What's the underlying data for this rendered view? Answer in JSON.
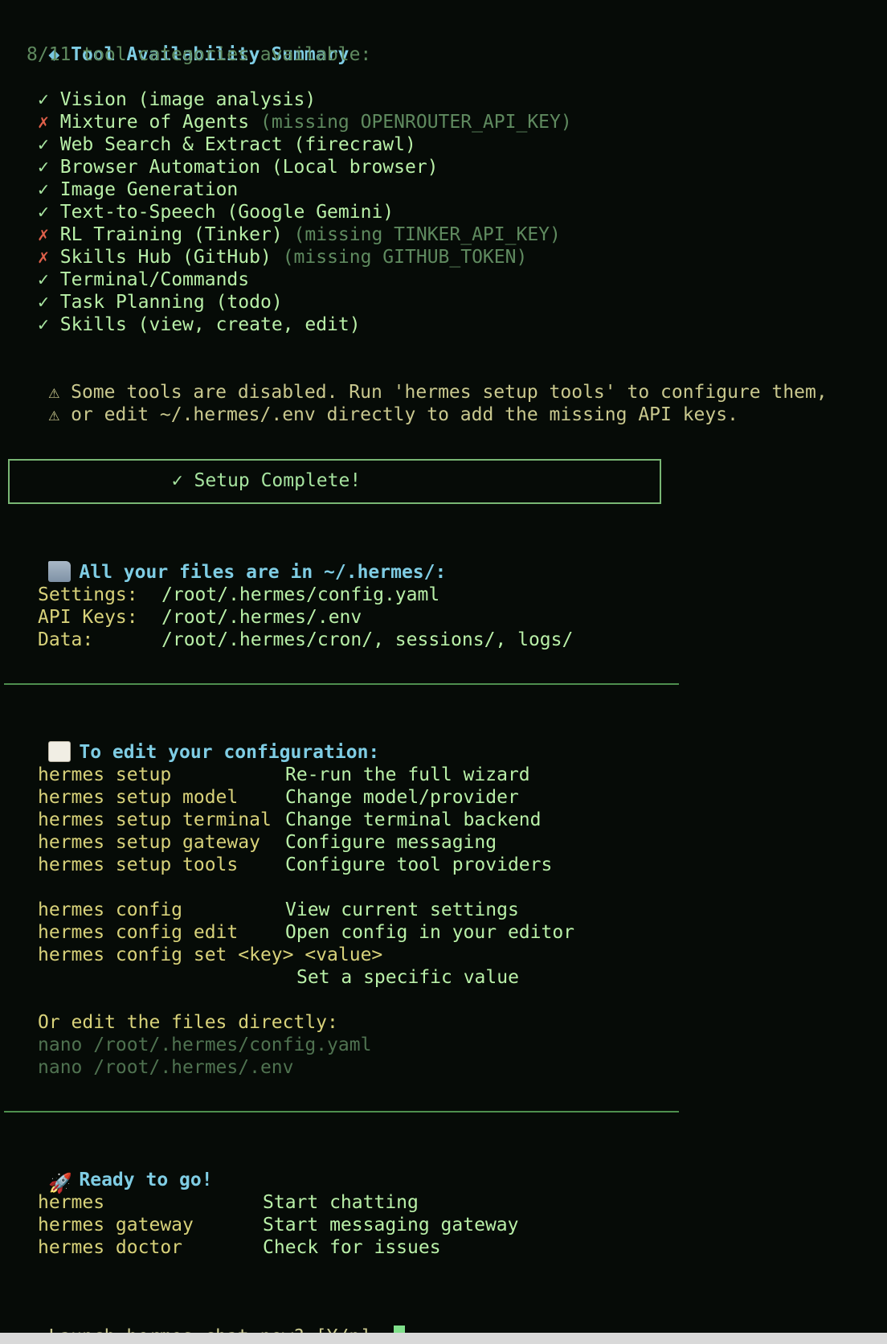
{
  "summary": {
    "bullet": "◆",
    "title": "Tool Availability Summary",
    "count_line": "8/11 tool categories available:"
  },
  "tools": [
    {
      "mark": "✓",
      "name": "Vision (image analysis)",
      "note": "",
      "ok": true
    },
    {
      "mark": "✗",
      "name": "Mixture of Agents",
      "note": "(missing OPENROUTER_API_KEY)",
      "ok": false
    },
    {
      "mark": "✓",
      "name": "Web Search & Extract (firecrawl)",
      "note": "",
      "ok": true
    },
    {
      "mark": "✓",
      "name": "Browser Automation (Local browser)",
      "note": "",
      "ok": true
    },
    {
      "mark": "✓",
      "name": "Image Generation",
      "note": "",
      "ok": true
    },
    {
      "mark": "✓",
      "name": "Text-to-Speech (Google Gemini)",
      "note": "",
      "ok": true
    },
    {
      "mark": "✗",
      "name": "RL Training (Tinker)",
      "note": "(missing TINKER_API_KEY)",
      "ok": false
    },
    {
      "mark": "✗",
      "name": "Skills Hub (GitHub)",
      "note": "(missing GITHUB_TOKEN)",
      "ok": false
    },
    {
      "mark": "✓",
      "name": "Terminal/Commands",
      "note": "",
      "ok": true
    },
    {
      "mark": "✓",
      "name": "Task Planning (todo)",
      "note": "",
      "ok": true
    },
    {
      "mark": "✓",
      "name": "Skills (view, create, edit)",
      "note": "",
      "ok": true
    }
  ],
  "warnings": [
    {
      "icon": "⚠",
      "text": "Some tools are disabled. Run 'hermes setup tools' to configure them,"
    },
    {
      "icon": "⚠",
      "text": "or edit ~/.hermes/.env directly to add the missing API keys."
    }
  ],
  "setup_box": {
    "text": "✓ Setup Complete!"
  },
  "files": {
    "heading": "All your files are in ~/.hermes/:",
    "rows": [
      {
        "label": "Settings:",
        "value": "/root/.hermes/config.yaml"
      },
      {
        "label": "API Keys:",
        "value": "/root/.hermes/.env"
      },
      {
        "label": "Data:",
        "value": "/root/.hermes/cron/, sessions/, logs/"
      }
    ]
  },
  "config": {
    "heading": "To edit your configuration:",
    "setup_cmds": [
      {
        "cmd": "hermes setup",
        "desc": "Re-run the full wizard"
      },
      {
        "cmd": "hermes setup model",
        "desc": "Change model/provider"
      },
      {
        "cmd": "hermes setup terminal",
        "desc": "Change terminal backend"
      },
      {
        "cmd": "hermes setup gateway",
        "desc": "Configure messaging"
      },
      {
        "cmd": "hermes setup tools",
        "desc": "Configure tool providers"
      }
    ],
    "config_cmds": [
      {
        "cmd": "hermes config",
        "desc": "View current settings"
      },
      {
        "cmd": "hermes config edit",
        "desc": "Open config in your editor"
      }
    ],
    "set_cmd": "hermes config set <key> <value>",
    "set_desc": "Set a specific value",
    "direct_heading": "Or edit the files directly:",
    "direct_cmds": [
      "nano /root/.hermes/config.yaml",
      "nano /root/.hermes/.env"
    ]
  },
  "ready": {
    "heading": "Ready to go!",
    "cmds": [
      {
        "cmd": "hermes",
        "desc": "Start chatting"
      },
      {
        "cmd": "hermes gateway",
        "desc": "Start messaging gateway"
      },
      {
        "cmd": "hermes doctor",
        "desc": "Check for issues"
      }
    ]
  },
  "prompt": {
    "text": "Launch hermes chat now? [Y/n]: "
  },
  "icons": {
    "folder": "folder-icon",
    "memo": "memo-icon",
    "rocket": "rocket-icon"
  },
  "colors": {
    "background": "#060b07",
    "heading": "#7fcde4",
    "text": "#a6e39f",
    "error": "#e0604a",
    "warning": "#c9c88e",
    "cursor": "#7fe08a"
  }
}
